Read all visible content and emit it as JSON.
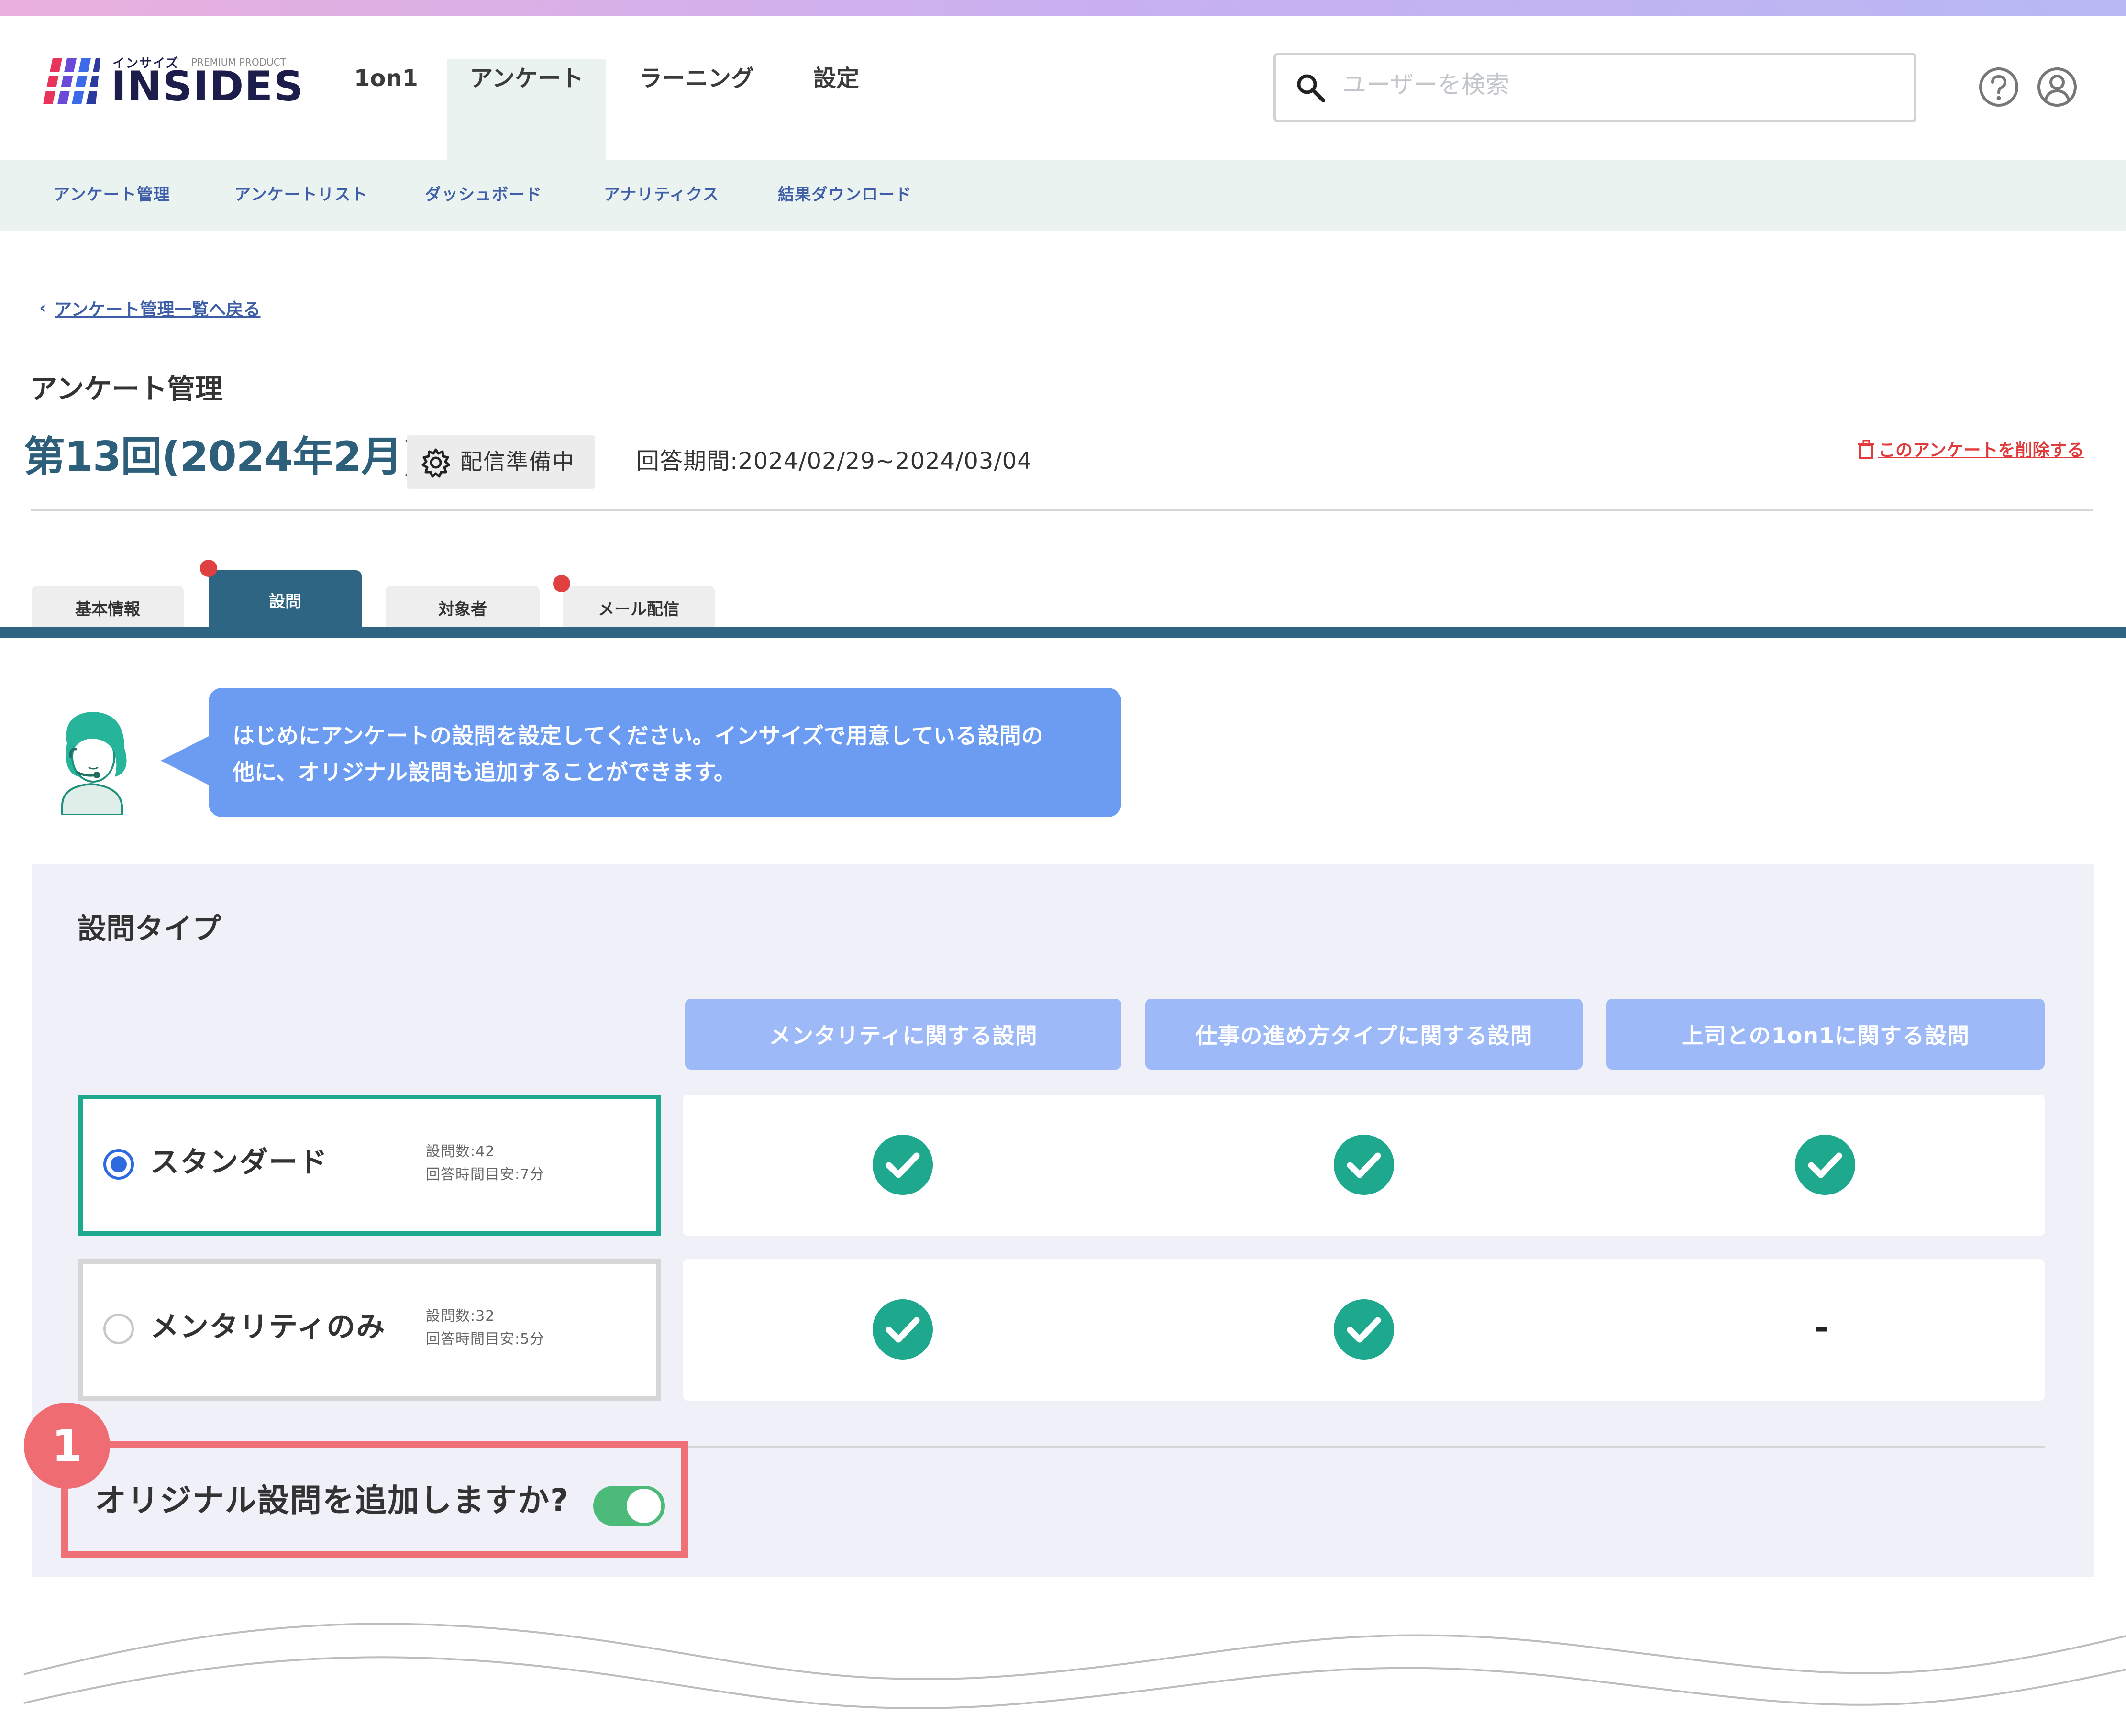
{
  "header": {
    "logo": {
      "kana": "インサイズ",
      "product": "PREMIUM PRODUCT",
      "name": "INSIDES"
    },
    "nav": [
      {
        "label": "1on1"
      },
      {
        "label": "アンケート",
        "active": true
      },
      {
        "label": "ラーニング"
      },
      {
        "label": "設定"
      }
    ],
    "search": {
      "placeholder": "ユーザーを検索",
      "icon": "search-icon"
    },
    "icons": [
      "help-icon",
      "user-account-icon"
    ]
  },
  "subnav": {
    "items": [
      {
        "label": "アンケート管理"
      },
      {
        "label": "アンケートリスト"
      },
      {
        "label": "ダッシュボード"
      },
      {
        "label": "アナリティクス"
      },
      {
        "label": "結果ダウンロード"
      }
    ]
  },
  "page": {
    "back_link": "アンケート管理一覧へ戻る",
    "section_label": "アンケート管理",
    "survey_title": "第13回(2024年2月)",
    "status": {
      "icon": "gear-icon",
      "label": "配信準備中"
    },
    "period": "回答期間:2024/02/29~2024/03/04",
    "delete_link": "このアンケートを削除する"
  },
  "tabs": [
    {
      "label": "基本情報",
      "active": false,
      "alert": false
    },
    {
      "label": "設問",
      "active": true,
      "alert": true
    },
    {
      "label": "対象者",
      "active": false,
      "alert": false
    },
    {
      "label": "メール配信",
      "active": false,
      "alert": true
    }
  ],
  "guide": {
    "avatar_icon": "support-operator-avatar",
    "line1": "はじめにアンケートの設問を設定してください。インサイズで用意している設問の",
    "line2": "他に、オリジナル設問も追加することができます。"
  },
  "question_type": {
    "title": "設問タイプ",
    "columns": [
      {
        "label": "メンタリティに関する設問"
      },
      {
        "label": "仕事の進め方タイプに関する設問"
      },
      {
        "label": "上司との1on1に関する設問"
      }
    ],
    "options": [
      {
        "label": "スタンダード",
        "selected": true,
        "count": "設問数:42",
        "time": "回答時間目安:7分",
        "includes": [
          true,
          true,
          true
        ]
      },
      {
        "label": "メンタリティのみ",
        "selected": false,
        "count": "設問数:32",
        "time": "回答時間目安:5分",
        "includes": [
          true,
          true,
          false
        ],
        "none_mark": "-"
      }
    ]
  },
  "original_question": {
    "step": "1",
    "label": "オリジナル設問を追加しますか?",
    "enabled": true
  },
  "colors": {
    "accent_teal": "#1ea98e",
    "tab_active": "#2d6583",
    "bubble": "#6b9cf2",
    "column_header": "#9db9f8",
    "highlight": "#f07078",
    "toggle_on": "#4cba78"
  }
}
